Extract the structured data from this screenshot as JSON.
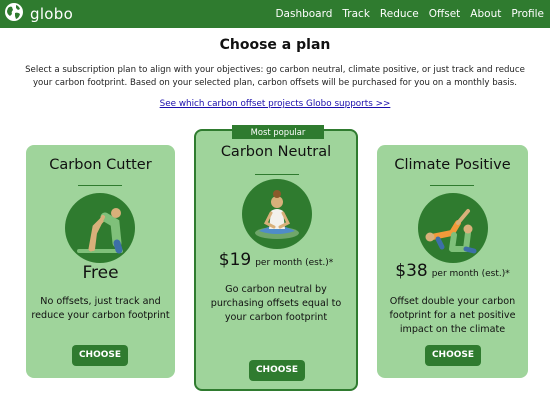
{
  "nav": {
    "brand": "globo",
    "links": [
      {
        "label": "Dashboard"
      },
      {
        "label": "Track"
      },
      {
        "label": "Reduce"
      },
      {
        "label": "Offset"
      },
      {
        "label": "About"
      },
      {
        "label": "Profile"
      }
    ]
  },
  "page": {
    "title": "Choose a plan",
    "description": "Select a subscription plan to align with your objectives: go carbon neutral, climate positive, or just track and reduce your carbon footprint. Based on your selected plan, carbon offsets will be purchased for you on a monthly basis.",
    "offset_link": "See which carbon offset projects Globo supports >>"
  },
  "plans": [
    {
      "title": "Carbon Cutter",
      "price": "Free",
      "price_unit": "",
      "description": "No offsets, just track and reduce your carbon footprint",
      "button": "CHOOSE",
      "icon": "forward-bend-pose-icon"
    },
    {
      "badge": "Most popular",
      "title": "Carbon Neutral",
      "price": "$19",
      "price_unit": "per month (est.)*",
      "description": "Go carbon neutral by purchasing offsets equal to your carbon footprint",
      "button": "CHOOSE",
      "icon": "meditation-pose-icon"
    },
    {
      "title": "Climate Positive",
      "price": "$38",
      "price_unit": "per month (est.)*",
      "description": "Offset double your carbon footprint for a net positive impact on the climate",
      "button": "CHOOSE",
      "icon": "partner-yoga-pose-icon"
    }
  ],
  "colors": {
    "brand_green": "#2f7b2f",
    "card_green": "#9fd49b",
    "link_blue": "#1a0dab"
  }
}
